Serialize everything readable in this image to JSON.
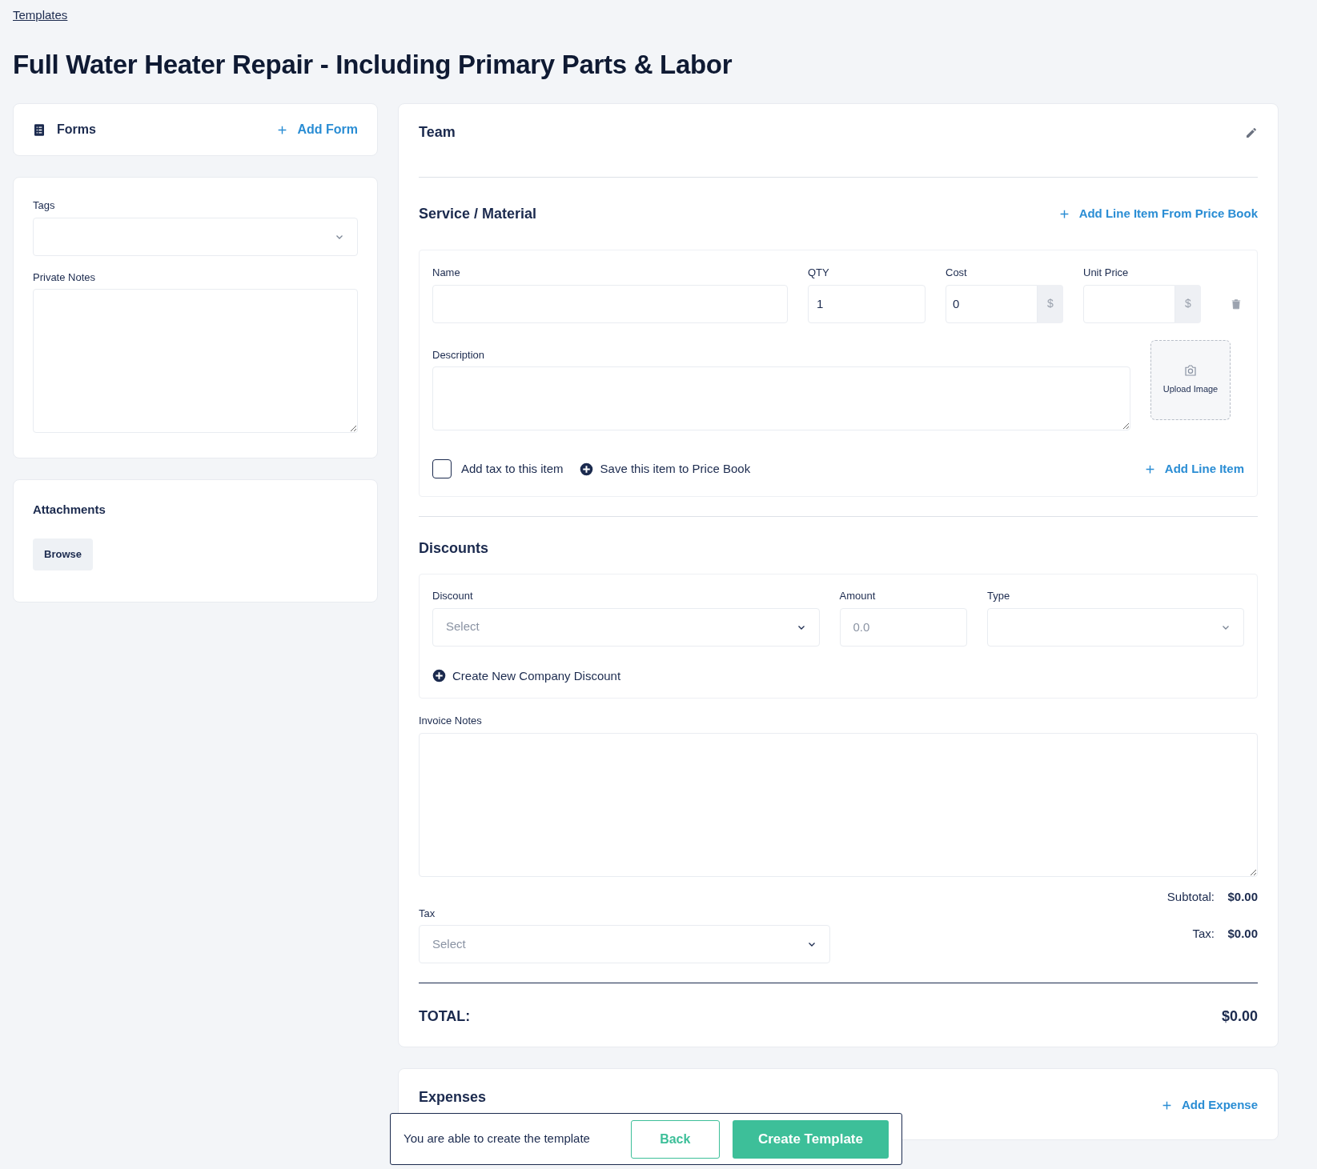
{
  "breadcrumb": "Templates",
  "title": "Full Water Heater Repair - Including Primary Parts & Labor",
  "forms": {
    "title": "Forms",
    "add_button": "Add Form"
  },
  "tags": {
    "label": "Tags"
  },
  "private_notes": {
    "label": "Private Notes"
  },
  "attachments": {
    "title": "Attachments",
    "button": "Browse"
  },
  "team": {
    "title": "Team"
  },
  "service": {
    "title": "Service / Material",
    "add_from_price_book": "Add Line Item From Price Book",
    "fields": [
      {
        "kind": "text",
        "label": "Name"
      },
      {
        "kind": "text",
        "label": "QTY",
        "value": "1"
      },
      {
        "kind": "currency",
        "label": "Cost",
        "value": "0",
        "addon": "$"
      },
      {
        "kind": "currency",
        "label": "Unit Price",
        "addon": "$"
      }
    ],
    "description_label": "Description",
    "upload": "Upload Image",
    "tax_item": {
      "label": "Add tax to this item",
      "checked": false
    },
    "save_to_price_book": "Save this item to Price Book",
    "add_line_item": "Add Line Item"
  },
  "discounts": {
    "title": "Discounts",
    "fields": [
      {
        "kind": "select",
        "label": "Discount",
        "placeholder": "Select"
      },
      {
        "kind": "text",
        "label": "Amount",
        "placeholder": "0.0"
      },
      {
        "kind": "select",
        "label": "Type"
      }
    ],
    "create": "Create New Company Discount"
  },
  "invoice_notes": {
    "label": "Invoice Notes"
  },
  "tax": {
    "label": "Tax",
    "placeholder": "Select"
  },
  "summary": [
    {
      "label": "Subtotal:",
      "value": "$0.00"
    },
    {
      "label": "Tax:",
      "value": "$0.00"
    }
  ],
  "total": {
    "label": "TOTAL:",
    "value": "$0.00"
  },
  "expenses": {
    "title": "Expenses",
    "add_button": "Add Expense"
  },
  "footer": {
    "message": "You are able to create the template",
    "back": "Back",
    "create": "Create Template"
  }
}
